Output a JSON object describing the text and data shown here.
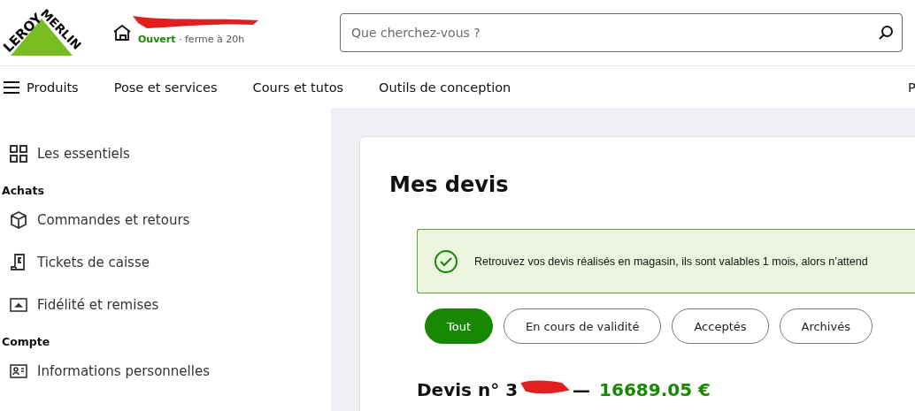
{
  "header": {
    "logo": {
      "left": "LEROY",
      "right": "MERLIN"
    },
    "store": {
      "status": "Ouvert",
      "hours": "· ferme à 20h"
    },
    "search": {
      "placeholder": "Que cherchez-vous ?"
    }
  },
  "nav": {
    "items": [
      {
        "label": "Produits",
        "kind": "menu"
      },
      {
        "label": "Pose et services",
        "kind": "link"
      },
      {
        "label": "Cours et tutos",
        "kind": "link"
      },
      {
        "label": "Outils de conception",
        "kind": "link"
      }
    ],
    "edge_item": "P"
  },
  "sidebar": {
    "groups": [
      {
        "items": [
          {
            "label": "Les essentiels",
            "kind": "grid"
          }
        ]
      },
      {
        "heading": "Achats",
        "items": [
          {
            "label": "Commandes et retours",
            "kind": "box"
          },
          {
            "label": "Tickets de caisse",
            "kind": "receipt"
          },
          {
            "label": "Fidélité et remises",
            "kind": "card"
          }
        ]
      },
      {
        "heading": "Compte",
        "items": [
          {
            "label": "Informations personnelles",
            "kind": "id"
          }
        ]
      }
    ]
  },
  "main": {
    "title": "Mes devis",
    "notice": "Retrouvez vos devis réalisés en magasin, ils sont valables 1 mois, alors n’attend",
    "filters": [
      {
        "label": "Tout",
        "selected": true
      },
      {
        "label": "En cours de validité",
        "selected": false
      },
      {
        "label": "Acceptés",
        "selected": false
      },
      {
        "label": "Archivés",
        "selected": false
      }
    ],
    "quote": {
      "title": "Devis n° 3",
      "dash": "—",
      "amount": "16689.05 €"
    }
  }
}
